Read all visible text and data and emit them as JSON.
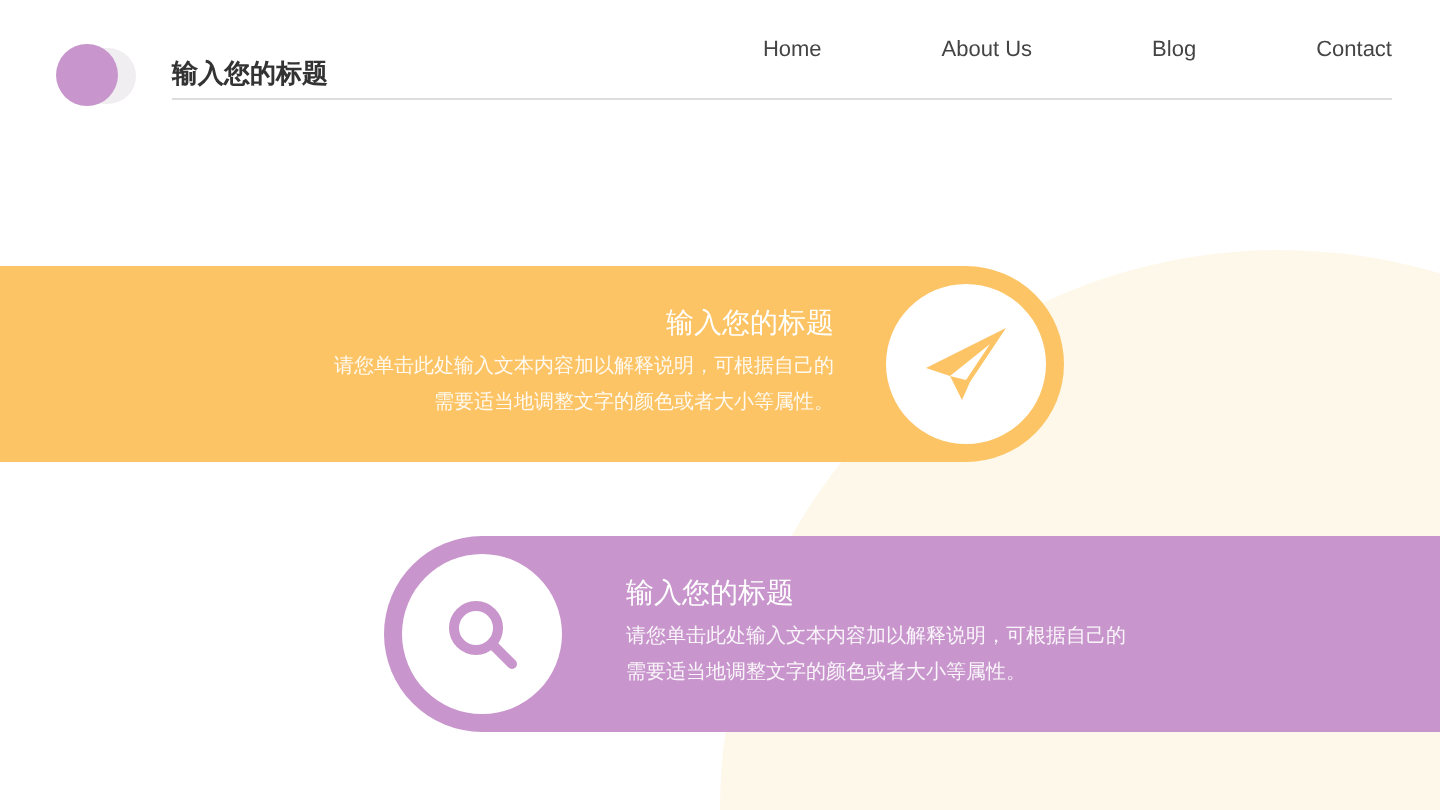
{
  "header": {
    "title": "输入您的标题",
    "nav": [
      {
        "label": "Home"
      },
      {
        "label": "About Us"
      },
      {
        "label": "Blog"
      },
      {
        "label": "Contact"
      }
    ]
  },
  "bands": [
    {
      "kind": "paper-plane",
      "color": "#fcc465",
      "title": "输入您的标题",
      "text": "请您单击此处输入文本内容加以解释说明，可根据自己的需要适当地调整文字的颜色或者大小等属性。"
    },
    {
      "kind": "magnifier",
      "color": "#c896cc",
      "title": "输入您的标题",
      "text": "请您单击此处输入文本内容加以解释说明，可根据自己的需要适当地调整文字的颜色或者大小等属性。"
    }
  ]
}
